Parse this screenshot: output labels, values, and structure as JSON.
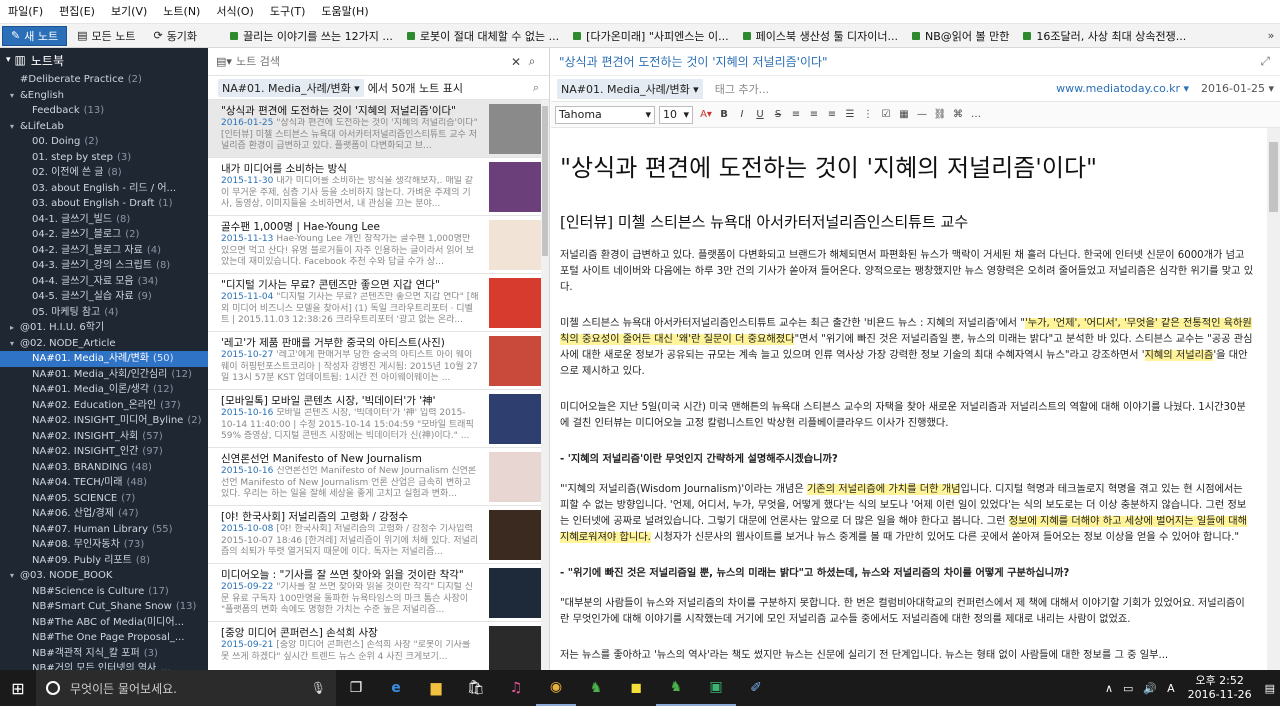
{
  "menu": [
    "파일(F)",
    "편집(E)",
    "보기(V)",
    "노트(N)",
    "서식(O)",
    "도구(T)",
    "도움말(H)"
  ],
  "toolbar": {
    "new_note": "새 노트",
    "all_notes": "모든 노트",
    "sync": "동기화",
    "shortcuts": [
      "끌리는 이야기를 쓰는 12가지 ...",
      "로봇이 절대 대체할 수 없는 ...",
      "[다가온미래] \"사피엔스는 이...",
      "페이스북 생산성 툴 디자이너...",
      "NB@읽어 볼 만한",
      "16조달러, 사상 최대 상속전쟁..."
    ]
  },
  "sidebar": {
    "title": "노트북",
    "items": [
      {
        "label": "#Deliberate Practice",
        "count": "(2)",
        "indent": 1,
        "arrow": ""
      },
      {
        "label": "&English",
        "count": "",
        "indent": 0,
        "arrow": "▾"
      },
      {
        "label": "Feedback",
        "count": "(13)",
        "indent": 2,
        "arrow": ""
      },
      {
        "label": "&LifeLab",
        "count": "",
        "indent": 0,
        "arrow": "▾"
      },
      {
        "label": "00. Doing",
        "count": "(2)",
        "indent": 2,
        "arrow": ""
      },
      {
        "label": "01. step by step",
        "count": "(3)",
        "indent": 2,
        "arrow": ""
      },
      {
        "label": "02. 이전에 쓴 글",
        "count": "(8)",
        "indent": 2,
        "arrow": ""
      },
      {
        "label": "03. about English - 리드 / 어...",
        "count": "",
        "indent": 2,
        "arrow": ""
      },
      {
        "label": "03. about English - Draft",
        "count": "(1)",
        "indent": 2,
        "arrow": ""
      },
      {
        "label": "04-1. 글쓰기_빌드",
        "count": "(8)",
        "indent": 2,
        "arrow": ""
      },
      {
        "label": "04-2. 글쓰기_블로그",
        "count": "(2)",
        "indent": 2,
        "arrow": ""
      },
      {
        "label": "04-2. 글쓰기_블로그 자료",
        "count": "(4)",
        "indent": 2,
        "arrow": ""
      },
      {
        "label": "04-3. 글쓰기_강의 스크립트",
        "count": "(8)",
        "indent": 2,
        "arrow": ""
      },
      {
        "label": "04-4. 글쓰기_자료 모음",
        "count": "(34)",
        "indent": 2,
        "arrow": ""
      },
      {
        "label": "04-5. 글쓰기_실습 자료",
        "count": "(9)",
        "indent": 2,
        "arrow": ""
      },
      {
        "label": "05. 마케팅 참고",
        "count": "(4)",
        "indent": 2,
        "arrow": ""
      },
      {
        "label": "@01. H.I.U. 6학기",
        "count": "",
        "indent": 0,
        "arrow": "▸"
      },
      {
        "label": "@02. NODE_Article",
        "count": "",
        "indent": 0,
        "arrow": "▾"
      },
      {
        "label": "NA#01. Media_사례/변화",
        "count": "(50)",
        "indent": 2,
        "arrow": "",
        "selected": true
      },
      {
        "label": "NA#01. Media_사회/인간심리",
        "count": "(12)",
        "indent": 2,
        "arrow": ""
      },
      {
        "label": "NA#01. Media_이론/생각",
        "count": "(12)",
        "indent": 2,
        "arrow": ""
      },
      {
        "label": "NA#02. Education_온라인",
        "count": "(37)",
        "indent": 2,
        "arrow": ""
      },
      {
        "label": "NA#02. INSIGHT_미디어_Byline",
        "count": "(2)",
        "indent": 2,
        "arrow": ""
      },
      {
        "label": "NA#02. INSIGHT_사회",
        "count": "(57)",
        "indent": 2,
        "arrow": ""
      },
      {
        "label": "NA#02. INSIGHT_인간",
        "count": "(97)",
        "indent": 2,
        "arrow": ""
      },
      {
        "label": "NA#03. BRANDING",
        "count": "(48)",
        "indent": 2,
        "arrow": ""
      },
      {
        "label": "NA#04. TECH/미래",
        "count": "(48)",
        "indent": 2,
        "arrow": ""
      },
      {
        "label": "NA#05. SCIENCE",
        "count": "(7)",
        "indent": 2,
        "arrow": ""
      },
      {
        "label": "NA#06. 산업/경제",
        "count": "(47)",
        "indent": 2,
        "arrow": ""
      },
      {
        "label": "NA#07. Human Library",
        "count": "(55)",
        "indent": 2,
        "arrow": ""
      },
      {
        "label": "NA#08. 무인자동차",
        "count": "(73)",
        "indent": 2,
        "arrow": ""
      },
      {
        "label": "NA#09. Publy 리포트",
        "count": "(8)",
        "indent": 2,
        "arrow": ""
      },
      {
        "label": "@03. NODE_BOOK",
        "count": "",
        "indent": 0,
        "arrow": "▾"
      },
      {
        "label": "NB#Science is Culture",
        "count": "(17)",
        "indent": 2,
        "arrow": ""
      },
      {
        "label": "NB#Smart Cut_Shane Snow",
        "count": "(13)",
        "indent": 2,
        "arrow": ""
      },
      {
        "label": "NB#The ABC of Media(미디어...",
        "count": "",
        "indent": 2,
        "arrow": ""
      },
      {
        "label": "NB#The One Page Proposal_...",
        "count": "",
        "indent": 2,
        "arrow": ""
      },
      {
        "label": "NB#객관적 지식_칼 포퍼",
        "count": "(3)",
        "indent": 2,
        "arrow": ""
      },
      {
        "label": "NB#거의 모든 인터넷의 역사_...",
        "count": "",
        "indent": 2,
        "arrow": ""
      },
      {
        "label": "NB#개으름에 대한 찬양_버트...",
        "count": "",
        "indent": 2,
        "arrow": ""
      },
      {
        "label": "NB#기계와의 경쟁 에릭 브린...",
        "count": "",
        "indent": 2,
        "arrow": ""
      }
    ]
  },
  "notelist": {
    "search_placeholder": "노트 검색",
    "notebook": "NA#01. Media_사례/변화 ▾",
    "summary": "에서 50개 노트 표시",
    "notes": [
      {
        "title": "\"상식과 편견에 도전하는 것이 '지혜의 저널리즘'이다\"",
        "date": "2016-01-25",
        "snippet": "\"상식과 편견에 도전하는 것이 '지혜의 저널리즘'이다\" [인터뷰] 미첼 스티븐스 뉴욕대 아서카터저널리즘인스티튜트 교수 저널리즘 환경이 급변하고 있다. 플랫폼이 다변화되고 브...",
        "thumb": "#8a8a8a",
        "selected": true
      },
      {
        "title": "내가 미디어를 소비하는 방식",
        "date": "2015-11-30",
        "snippet": "내가 미디어를 소비하는 방식을 생각해보자,. 매일 같이 무거운 주제, 심층 기사 등을 소비하지 않는다. 가벼운 주제의 기사, 동영상, 이미지들을 소비하면서, 내 관심을 끄는 분야...",
        "thumb": "#6b3f7a"
      },
      {
        "title": "골수팬 1,000명 | Hae-Young Lee",
        "date": "2015-11-13",
        "snippet": "Hae-Young Lee 개인 창작가는 골수팬 1,000명만 있으면 먹고 산다! 유명 블로거들이 자주 인용하는 글이라서 읽어 보았는데 재미있습니다. Facebook 추천 수와 답글 수가 상...",
        "thumb": "#f1e4d6"
      },
      {
        "title": "\"디지털 기사는 무료? 콘텐즈만 좋으면 지갑 연다\"",
        "date": "2015-11-04",
        "snippet": "\"디지털 기사는 무료? 콘텐츠만 좋으면 지갑 연다\" [해외 미디어 비즈니스 모델을 찾아서] (1) 독일 크라우트리포터 · 디벨트 | 2015.11.03 12:38:26 크라우트리포터 '광고 없는 온라...",
        "thumb": "#d63b2e"
      },
      {
        "title": "'레고'가 제품 판매를 거부한 중국의 아티스트(사진)",
        "date": "2015-10-27",
        "snippet": "'레고'에게 판매거부 당한 중국의 아티스트 아이 웨이웨이 허핑턴포스트코리아 | 작성자 강병진 게시됨: 2015년 10월 27일 13시 57분 KST 업데이트됨: 1시간 전 아이웨이웨이는 ...",
        "thumb": "#c94a3a"
      },
      {
        "title": "[모바일톡] 모바일 콘텐츠 시장, '빅데이터'가 '神'",
        "date": "2015-10-16",
        "snippet": "모바일 콘텐츠 시장, '빅데이터'가 '神' 입력 2015-10-14 11:40:00 | 수정 2015-10-14 15:04:59 \"모바일 트래픽 59% 증영상, 디지털 콘텐츠 시장에는 빅데이터가 신(神)이다.\" ...",
        "thumb": "#2e3e6e"
      },
      {
        "title": "신연론선언 Manifesto of New Journalism",
        "date": "2015-10-16",
        "snippet": "신연론선언 Manifesto of New Journalism 신연론 선언 Manifesto of New Journalism 언론 산업은 급속히 변하고 있다. 우리는 하는 일을 잘해 세상을 좋게 고치고 실험과 변화...",
        "thumb": "#e8d6d2"
      },
      {
        "title": "[야! 한국사회] 저널리즘의 고령화 / 강정수",
        "date": "2015-10-08",
        "snippet": "[야! 한국사회] 저널리즘의 고령화 / 강정수 기사입력 2015-10-07 18:46 [한겨레] 저널리즘이 위기에 처해 있다. 저널리즘의 쇠퇴가 뚜렷 열거되지 때문에 이다. 독자는 저널리즘...",
        "thumb": "#3a2a20"
      },
      {
        "title": "미디어오늘 : \"기사를 잘 쓰면 찾아와 읽을 것이란 착각\"",
        "date": "2015-09-22",
        "snippet": "\"기사를 잘 쓰면 찾아와 읽을 것이란 착각\" 디지털 신문 유료 구독자 100만명을 돌파한 뉴욕타임스의 마크 톰슨 사장이 \"플랫폼의 변화 속에도 명형한 가치는 수준 높은 저널리즘...",
        "thumb": "#1e2a3a"
      },
      {
        "title": "[중앙 미디어 콘퍼런스] 손석희 사장",
        "date": "2015-09-21",
        "snippet": "[중앙 미디어 콘퍼런스] 손석희 사장 \"로봇이 기사를 못 쓰게 하겠다\" 싶시간 트렌드 뉴스 순위 4 사진 크게보기...",
        "thumb": "#2a2a2a"
      }
    ]
  },
  "editor": {
    "title_link": "\"상식과 편견어 도전하는 것이 '지혜의 저널리즘'이다\"",
    "notebook": "NA#01. Media_사례/변화 ▾",
    "tag_placeholder": "태그 추가...",
    "url": "www.mediatoday.co.kr ▾",
    "date": "2016-01-25 ▾",
    "font": "Tahoma",
    "size": "10",
    "h1": "\"상식과 편견에 도전하는 것이 '지혜의 저널리즘'이다\"",
    "h2": "[인터뷰] 미첼 스티븐스 뉴욕대 아서카터저널리즘인스티튜트 교수",
    "p1": "저널리즘 환경이 급변하고 있다. 플랫폼이 다변화되고 브랜드가 해체되면서 파편화된 뉴스가 맥락이 거세된 채 흘러 다닌다. 한국에 인터넷 신문이 6000개가 넘고 포털 사이트 네이버와 다음에는 하루 3만 건의 기사가 쏟아져 들어온다. 양적으로는 팽창했지만 뉴스 영향력은 오히려 줄어들었고 저널리즘은 심각한 위기를 맞고 있다.",
    "p2a": "미첼 스티븐스 뉴욕대 아서카터저널리즘인스티튜트 교수는 최근 출간한 '비욘드 뉴스 : 지혜의 저널리즘'에서 \"",
    "p2h1": "'누가, '언제', '어디서', '무엇을' 같은 전통적인 육하원칙의 중요성이 줄어든 대신 '왜'란 질문이 더 중요해졌다",
    "p2b": "\"면서 \"위기에 빠진 것은 저널리즘일 뿐, 뉴스의 미래는 밝다\"고 분석한 바 있다. 스티븐스 교수는 \"공공 관심사에 대한 새로운 정보가 공유되는 규모는 계속 늘고 있으며 인류 역사상 가장 강력한 정보 기술의 최대 수혜자역시 뉴스\"라고 강조하면서 '",
    "p2h2": "지혜의 저널리즘",
    "p2c": "'을 대안으로 제시하고 있다.",
    "p3": "미디어오늘은 지난 5일(미국 시간) 미국 맨해튼의 뉴욕대 스티븐스 교수의 자택을 찾아 새로운 저널리즘과 저널리스트의 역할에 대해 이야기를 나눴다. 1시간30분에 걸친 인터뷰는 미디어오늘 고정 칼럼니스트인 박상현 리플베이클라우드 이사가 진행했다.",
    "q1": "- '지혜의 저널리즘'이란 무엇인지 간략하게 설명해주시겠습니까?",
    "p4a": "\"'지혜의 저널리즘(Wisdom Journalism)'이라는 개념은 ",
    "p4h1": "기존의 저널리즘에 가치를 더한 개념",
    "p4b": "입니다. 디지털 혁명과 테크놀로지 혁명을 겪고 있는 현 시점에서는 피할 수 없는 방향입니다. '언제, 어디서, 누가, 무엇을, 어떻게 했다'는 식의 보도나 '어제 이런 일이 있었다'는 식의 보도로는 더 이상 충분하지 않습니다. 그런 정보는 인터넷에 공짜로 널려있습니다. 그렇기 대문에 언론사는 앞으로 더 많은 일을 해야 한다고 봅니다. 그런 ",
    "p4h2": "정보에 지혜를 더해야 하고 세상에 벌어지는 일들에 대해 지혜로워져야 합니다.",
    "p4c": " 시청자가 신문사의 웹사이트를 보거나 뉴스 중계를 볼 때 가만히 있어도 다른 곳에서 쏟아져 들어오는 정보 이상을 얻을 수 있어야 합니다.\"",
    "q2": "- \"위기에 빠진 것은 저널리즘일 뿐, 뉴스의 미래는 밝다\"고 하셨는데, 뉴스와 저널리즘의 차이를 어떻게 구분하십니까?",
    "p5": "\"대부분의 사람들이 뉴스와 저널리즘의 차이를 구분하지 못합니다. 한 번은 컬럼비아대학교의 컨퍼런스에서 제 책에 대해서 이야기할 기회가 있었어요. 저널리즘이란 무엇인가에 대해 이야기를 시작했는데 거기에 모인 저널리즘 교수들 중에서도 저널리즘에 대한 정의를 제대로 내리는 사람이 없었죠.",
    "p6": "저는 뉴스를 좋아하고 '뉴스의 역사'라는 책도 썼지만 뉴스는 신문에 실리기 전 단계입니다. 뉴스는 형태 없이 사람들에 대한 정보를 그 중 일부..."
  },
  "taskbar": {
    "search_placeholder": "무엇이든 물어보세요.",
    "time": "오후 2:52",
    "date": "2016-11-26",
    "ime": "A"
  }
}
